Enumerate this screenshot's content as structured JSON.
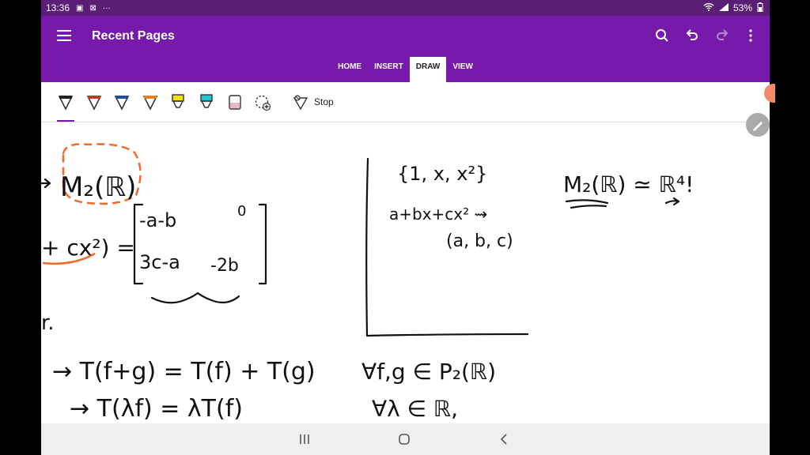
{
  "status": {
    "time": "13:36",
    "battery": "53%"
  },
  "appbar": {
    "title": "Recent Pages"
  },
  "tabs": [
    {
      "label": "HOME"
    },
    {
      "label": "INSERT"
    },
    {
      "label": "DRAW",
      "active": true
    },
    {
      "label": "VIEW"
    }
  ],
  "toolbar": {
    "stop_label": "Stop",
    "pens": [
      {
        "name": "black-pen",
        "color": "#222222"
      },
      {
        "name": "red-pen",
        "color": "#c0392b"
      },
      {
        "name": "blue-pen",
        "color": "#1f4e9c"
      },
      {
        "name": "orange-pen",
        "color": "#e67e22"
      },
      {
        "name": "yellow-highlighter",
        "color": "#f1e30a"
      },
      {
        "name": "cyan-highlighter",
        "color": "#22c7d6"
      },
      {
        "name": "pink-highlighter",
        "color": "#e7b6c8"
      }
    ]
  },
  "handwriting": {
    "m2r": "M₂(ℝ)",
    "eq_left": "+ cx²) =",
    "matrix": [
      "-a-b",
      "0",
      "3c-a",
      "-2b"
    ],
    "r_dot": "r.",
    "t_add": "→ T(f+g) = T(f) + T(g)",
    "forall_fg": "∀f,g ∈ P₂(ℝ)",
    "t_scalar": "→  T(λf) = λT(f)",
    "forall_lambda": "∀λ ∈ ℝ,",
    "basis": "{1, x, x²}",
    "poly": "a+bx+cx² ⇝",
    "tuple": "(a, b, c)",
    "iso": "M₂(ℝ) ≃ ℝ⁴!"
  }
}
